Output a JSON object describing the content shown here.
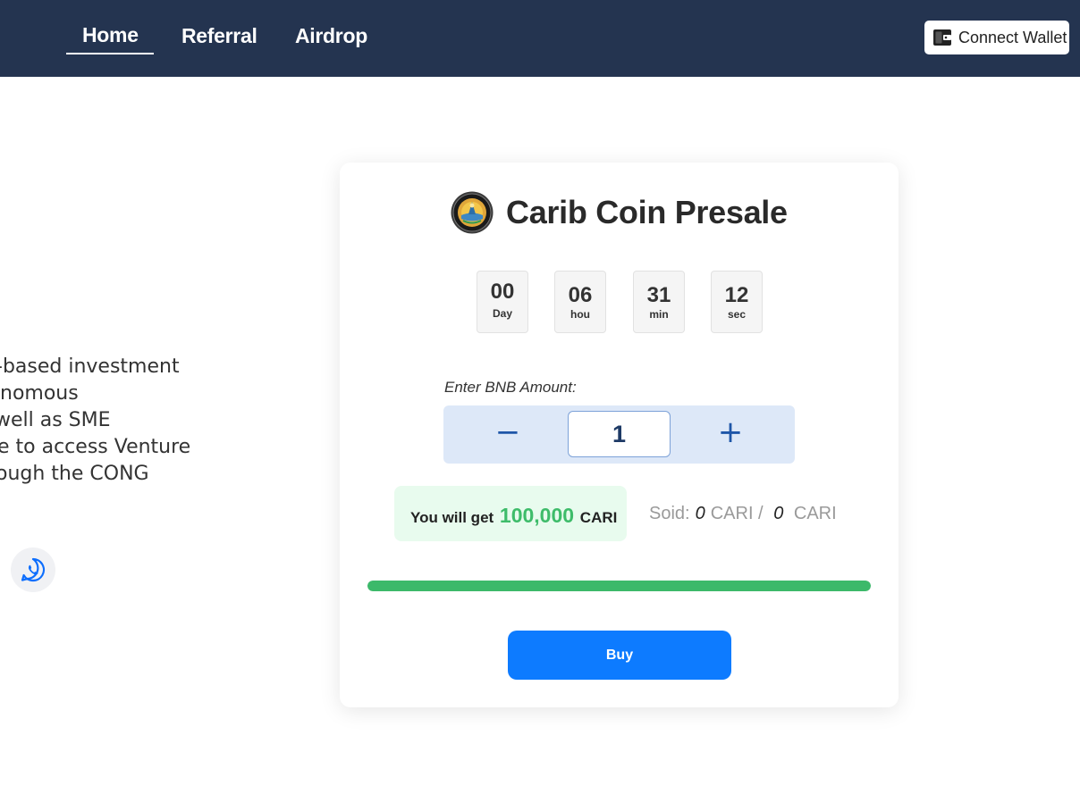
{
  "nav": {
    "links": [
      {
        "label": "Home",
        "active": true
      },
      {
        "label": "Referral",
        "active": false
      },
      {
        "label": "Airdrop",
        "active": false
      }
    ],
    "connect_wallet_label": "Connect Wallet"
  },
  "intro": {
    "lines": [
      "-based investment",
      "nomous",
      "well as SME",
      "e to access Venture",
      "ough the CONG"
    ],
    "social_icon": "whatsapp-icon"
  },
  "presale": {
    "title": "Carib Coin Presale",
    "countdown": [
      {
        "value": "00",
        "unit": "Day"
      },
      {
        "value": "06",
        "unit": "hou"
      },
      {
        "value": "31",
        "unit": "min"
      },
      {
        "value": "12",
        "unit": "sec"
      }
    ],
    "amount_label": "Enter BNB Amount:",
    "amount_value": "1",
    "minus_symbol": "−",
    "plus_symbol": "+",
    "get_prefix": "You will get",
    "get_amount": "100,000",
    "get_unit": "CARI",
    "sold_label": "Soid:",
    "sold_value": "0",
    "sold_unit": "CARI /",
    "total_value": "0",
    "total_unit": "CARI",
    "progress_fraction": 1.0,
    "buy_label": "Buy"
  },
  "colors": {
    "navbar": "#243450",
    "accent": "#0d7bff",
    "progress": "#3cb96a",
    "highlight_green": "#3ebc6a"
  }
}
